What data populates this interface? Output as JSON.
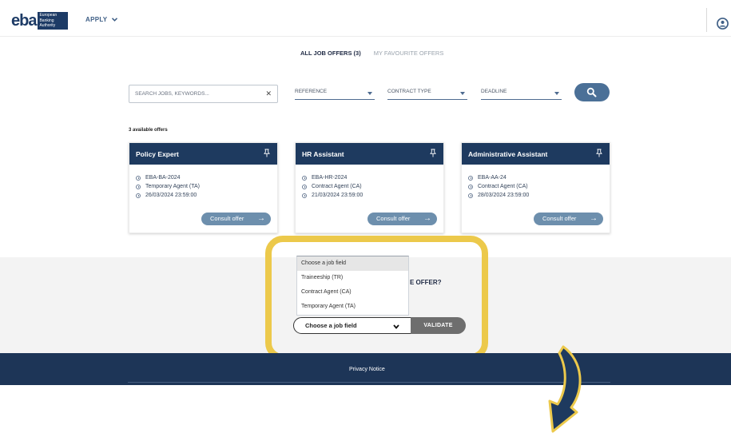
{
  "header": {
    "logo_word": "eba",
    "logo_lines": [
      "European",
      "Banking",
      "Authority"
    ],
    "apply_label": "APPLY"
  },
  "tabs": {
    "all": "ALL JOB OFFERS (3)",
    "favourites": "MY FAVOURITE OFFERS"
  },
  "filters": {
    "search_placeholder": "SEARCH JOBS, KEYWORDS...",
    "reference": "REFERENCE",
    "contract_type": "CONTRACT TYPE",
    "deadline": "DEADLINE"
  },
  "available_text": "3 available offers",
  "jobs": [
    {
      "title": "Policy Expert",
      "reference": "EBA-BA-2024",
      "contract": "Temporary Agent (TA)",
      "deadline": "26/03/2024 23:59:00",
      "button": "Consult offer"
    },
    {
      "title": "HR Assistant",
      "reference": "EBA-HR-2024",
      "contract": "Contract Agent (CA)",
      "deadline": "21/03/2024 23:59:00",
      "button": "Consult offer"
    },
    {
      "title": "Administrative Assistant",
      "reference": "EBA-AA-24",
      "contract": "Contract Agent (CA)",
      "deadline": "28/03/2024 23:59:00",
      "button": "Consult offer"
    }
  ],
  "spontaneous": {
    "question_fragment": "E OFFER?",
    "options": [
      "Choose a job field",
      "Traineeship (TR)",
      "Contract Agent (CA)",
      "Temporary Agent (TA)"
    ],
    "selected": "Choose a job field",
    "validate_label": "VALIDATE"
  },
  "footer": {
    "privacy": "Privacy Notice"
  },
  "colors": {
    "navy": "#1e3a5f",
    "highlight": "#ecc94b",
    "button_blue": "#4b7097"
  }
}
